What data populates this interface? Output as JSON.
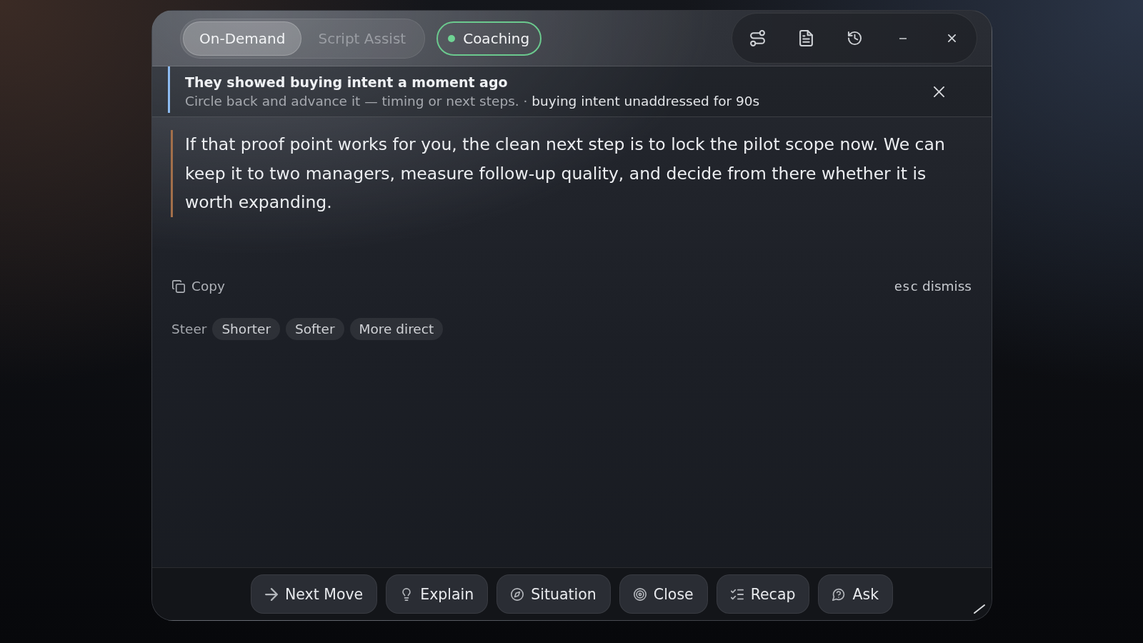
{
  "mode_tabs": [
    {
      "label": "On-Demand",
      "selected": true
    },
    {
      "label": "Script Assist",
      "selected": false
    }
  ],
  "coaching_toggle": {
    "label": "Coaching",
    "on": true
  },
  "alert": {
    "title": "They showed buying intent a moment ago",
    "message": "Circle back and advance it — timing or next steps.",
    "separator": "·",
    "detail": "buying intent unaddressed for 90s"
  },
  "suggestion": {
    "text": "If that proof point works for you, the clean next step is to lock the pilot scope now. We can keep it to two managers, measure follow-up quality, and decide from there whether it is worth expanding."
  },
  "copy_button": {
    "label": "Copy"
  },
  "dismiss_hint": {
    "key": "esc",
    "label": "dismiss"
  },
  "steer": {
    "label": "Steer",
    "options": [
      {
        "label": "Shorter"
      },
      {
        "label": "Softer"
      },
      {
        "label": "More direct"
      }
    ]
  },
  "actions": [
    {
      "label": "Next Move"
    },
    {
      "label": "Explain"
    },
    {
      "label": "Situation"
    },
    {
      "label": "Close"
    },
    {
      "label": "Recap"
    },
    {
      "label": "Ask"
    }
  ]
}
